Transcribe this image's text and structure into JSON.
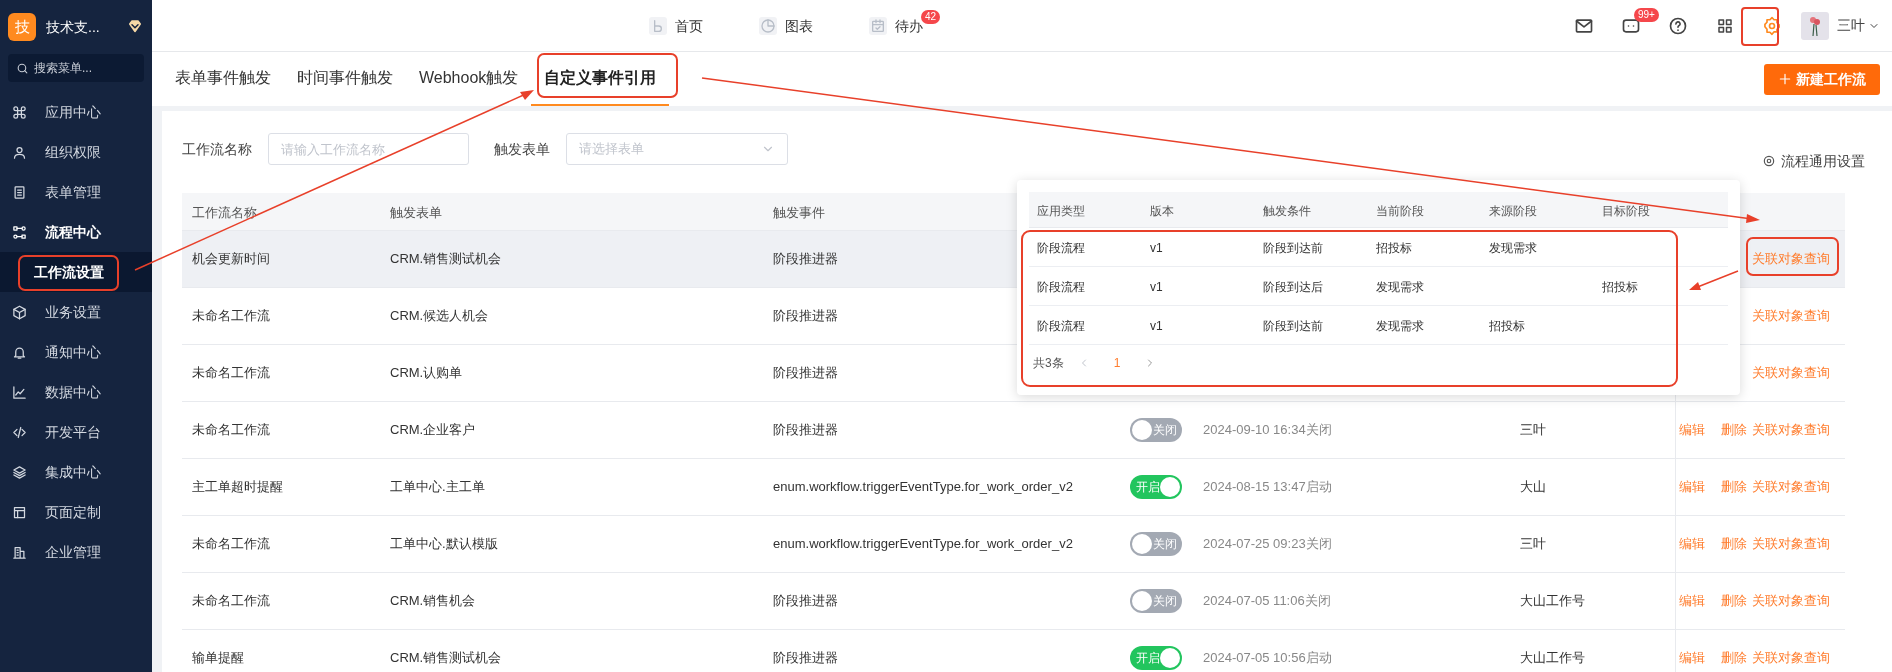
{
  "sidebar": {
    "logo_char": "技",
    "org_name": "技术支...",
    "search_placeholder": "搜索菜单...",
    "items": [
      {
        "label": "应用中心",
        "expanded": false
      },
      {
        "label": "组织权限",
        "expanded": false
      },
      {
        "label": "表单管理",
        "expanded": false
      },
      {
        "label": "流程中心",
        "expanded": true,
        "children": [
          {
            "label": "工作流设置",
            "selected": true
          }
        ]
      },
      {
        "label": "业务设置",
        "expanded": false
      },
      {
        "label": "通知中心",
        "expanded": false
      },
      {
        "label": "数据中心",
        "expanded": false
      },
      {
        "label": "开发平台",
        "expanded": false
      },
      {
        "label": "集成中心",
        "expanded": false
      },
      {
        "label": "页面定制",
        "expanded": false
      },
      {
        "label": "企业管理",
        "expanded": false
      }
    ]
  },
  "topbar": {
    "nav": [
      {
        "label": "首页"
      },
      {
        "label": "图表"
      },
      {
        "label": "待办",
        "badge": "42"
      }
    ],
    "message_badge": "99+",
    "user": "三叶"
  },
  "tabs": [
    {
      "label": "表单事件触发",
      "selected": false
    },
    {
      "label": "时间事件触发",
      "selected": false
    },
    {
      "label": "Webhook触发",
      "selected": false
    },
    {
      "label": "自定义事件引用",
      "selected": true
    }
  ],
  "new_button": "新建工作流",
  "filters": [
    {
      "kind": "input",
      "label": "工作流名称",
      "placeholder": "请输入工作流名称"
    },
    {
      "kind": "select",
      "label": "触发表单",
      "placeholder": "请选择表单"
    }
  ],
  "settings_link": "流程通用设置",
  "table": {
    "columns": [
      "工作流名称",
      "触发表单",
      "触发事件"
    ],
    "rows": [
      {
        "name": "机会更新时间",
        "form": "CRM.销售测试机会",
        "event": "阶段推进器",
        "hovered": true,
        "actions": [
          {
            "kind": "query",
            "label": "关联对象查询"
          }
        ]
      },
      {
        "name": "未命名工作流",
        "form": "CRM.候选人机会",
        "event": "阶段推进器",
        "hovered": false,
        "actions": [
          {
            "kind": "query",
            "label": "关联对象查询"
          }
        ]
      },
      {
        "name": "未命名工作流",
        "form": "CRM.认购单",
        "event": "阶段推进器",
        "hovered": false,
        "actions": [
          {
            "kind": "query",
            "label": "关联对象查询"
          }
        ]
      },
      {
        "name": "未命名工作流",
        "form": "CRM.企业客户",
        "event": "阶段推进器",
        "hovered": false,
        "status": {
          "on": false,
          "label": "关闭"
        },
        "time": "2024-09-10 16:34关闭",
        "creator": "三叶",
        "actions": [
          {
            "kind": "edit",
            "label": "编辑"
          },
          {
            "kind": "delete",
            "label": "删除"
          },
          {
            "kind": "query",
            "label": "关联对象查询"
          }
        ]
      },
      {
        "name": "主工单超时提醒",
        "form": "工单中心.主工单",
        "event": "enum.workflow.triggerEventType.for_work_order_v2",
        "hovered": false,
        "status": {
          "on": true,
          "label": "开启"
        },
        "time": "2024-08-15 13:47启动",
        "creator": "大山",
        "actions": [
          {
            "kind": "edit",
            "label": "编辑"
          },
          {
            "kind": "delete",
            "label": "删除"
          },
          {
            "kind": "query",
            "label": "关联对象查询"
          }
        ]
      },
      {
        "name": "未命名工作流",
        "form": "工单中心.默认模版",
        "event": "enum.workflow.triggerEventType.for_work_order_v2",
        "hovered": false,
        "status": {
          "on": false,
          "label": "关闭"
        },
        "time": "2024-07-25 09:23关闭",
        "creator": "三叶",
        "actions": [
          {
            "kind": "edit",
            "label": "编辑"
          },
          {
            "kind": "delete",
            "label": "删除"
          },
          {
            "kind": "query",
            "label": "关联对象查询"
          }
        ]
      },
      {
        "name": "未命名工作流",
        "form": "CRM.销售机会",
        "event": "阶段推进器",
        "hovered": false,
        "status": {
          "on": false,
          "label": "关闭"
        },
        "time": "2024-07-05 11:06关闭",
        "creator": "大山工作号",
        "actions": [
          {
            "kind": "edit",
            "label": "编辑"
          },
          {
            "kind": "delete",
            "label": "删除"
          },
          {
            "kind": "query",
            "label": "关联对象查询"
          }
        ]
      },
      {
        "name": "输单提醒",
        "form": "CRM.销售测试机会",
        "event": "阶段推进器",
        "hovered": false,
        "status": {
          "on": true,
          "label": "开启"
        },
        "time": "2024-07-05 10:56启动",
        "creator": "大山工作号",
        "actions": [
          {
            "kind": "edit",
            "label": "编辑"
          },
          {
            "kind": "delete",
            "label": "删除"
          },
          {
            "kind": "query",
            "label": "关联对象查询"
          }
        ]
      }
    ]
  },
  "popup": {
    "columns": [
      "应用类型",
      "版本",
      "触发条件",
      "当前阶段",
      "来源阶段",
      "目标阶段"
    ],
    "rows": [
      {
        "app_type": "阶段流程",
        "version": "v1",
        "condition": "阶段到达前",
        "current_stage": "招投标",
        "source_stage": "发现需求"
      },
      {
        "app_type": "阶段流程",
        "version": "v1",
        "condition": "阶段到达后",
        "current_stage": "发现需求",
        "target_stage": "招投标"
      },
      {
        "app_type": "阶段流程",
        "version": "v1",
        "condition": "阶段到达前",
        "current_stage": "发现需求",
        "source_stage": "招投标"
      }
    ],
    "total": "共3条",
    "page": "1"
  }
}
